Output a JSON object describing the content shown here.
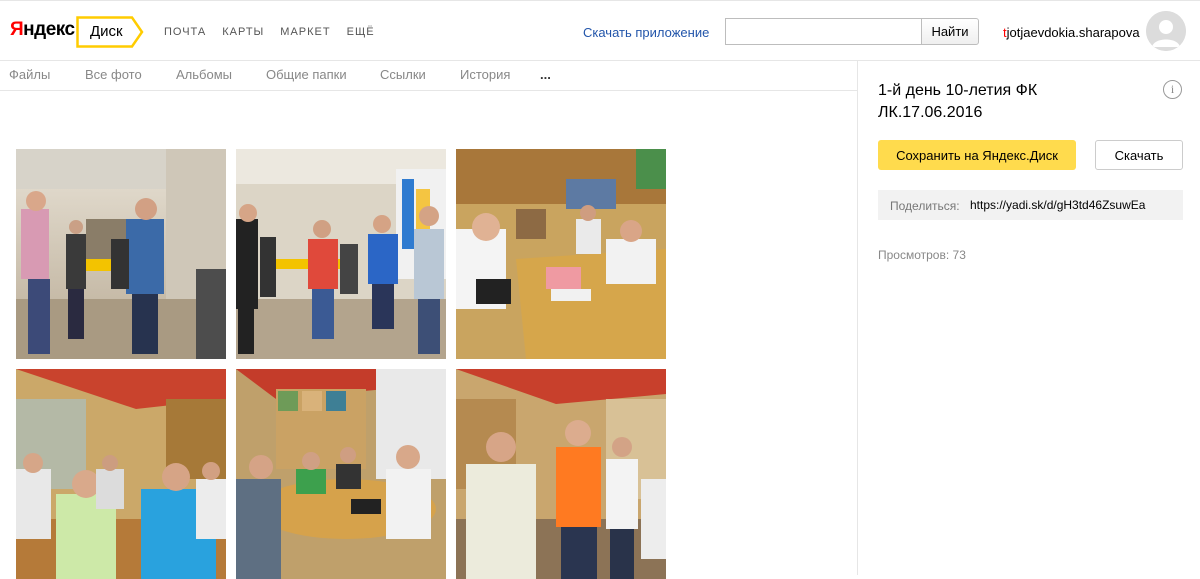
{
  "header": {
    "logo_first": "Я",
    "logo_rest": "ндекс",
    "disk_tab": "Диск",
    "services": [
      "ПОЧТА",
      "КАРТЫ",
      "МАРКЕТ",
      "ЕЩЁ"
    ],
    "get_app_link": "Скачать приложение",
    "search_value": "",
    "search_button": "Найти",
    "username_first": "t",
    "username_rest": "jotjaevdokia.sharapova"
  },
  "subnav": {
    "items": [
      "Файлы",
      "Все фото",
      "Альбомы",
      "Общие папки",
      "Ссылки",
      "История",
      "..."
    ]
  },
  "photos": [
    {
      "scene": "underpass-group"
    },
    {
      "scene": "underpass-line"
    },
    {
      "scene": "cafe-table"
    },
    {
      "scene": "cafe-seated"
    },
    {
      "scene": "cafe-round-table"
    },
    {
      "scene": "cafe-standing"
    }
  ],
  "sidebar": {
    "title": "1-й день 10-летия ФК ЛК.17.06.2016",
    "info_icon": "i",
    "save_button": "Сохранить на Яндекс.Диск",
    "download_button": "Скачать",
    "share_label": "Поделиться:",
    "share_url": "https://yadi.sk/d/gH3td46ZsuwEa",
    "views": "Просмотров: 73"
  },
  "colors": {
    "accent_yellow": "#ffdb4d",
    "link_blue": "#2255aa",
    "logo_red": "#ff0000"
  }
}
